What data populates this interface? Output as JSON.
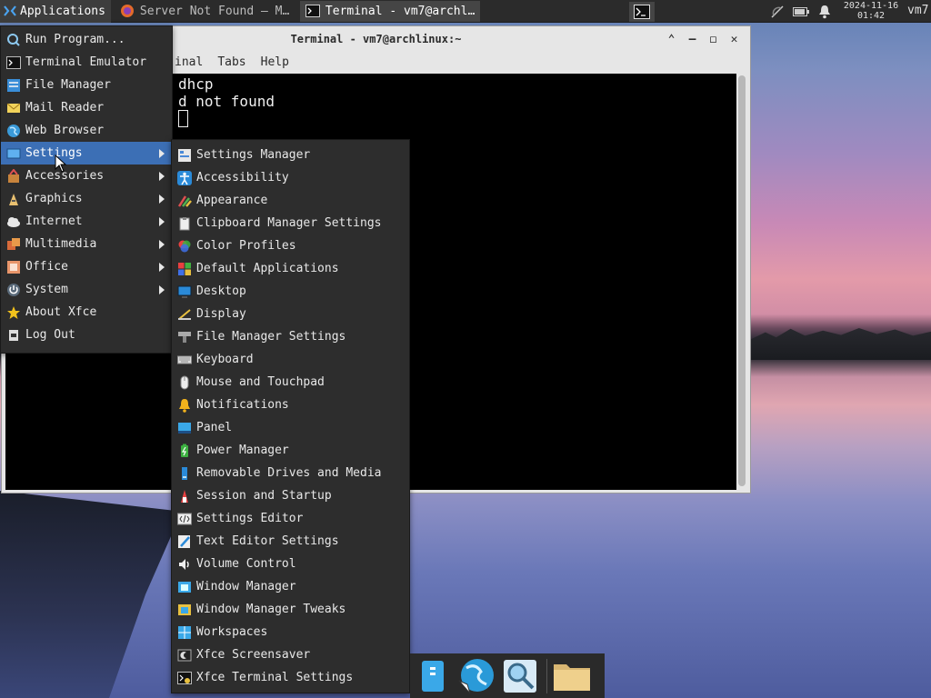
{
  "panel": {
    "applications_label": "Applications",
    "tasks": [
      {
        "label": "Server Not Found — M…",
        "active": false
      },
      {
        "label": "Terminal - vm7@archl…",
        "active": true
      }
    ],
    "clock_date": "2024-11-16",
    "clock_time": "01:42",
    "user": "vm7"
  },
  "terminal": {
    "title": "Terminal - vm7@archlinux:~",
    "menus": [
      "inal",
      "Tabs",
      "Help"
    ],
    "lines": [
      "dhcp",
      "d not found"
    ]
  },
  "main_menu": {
    "items": [
      {
        "label": "Run Program...",
        "icon": "run-icon",
        "submenu": false
      },
      {
        "label": "Terminal Emulator",
        "icon": "terminal-icon",
        "submenu": false
      },
      {
        "label": "File Manager",
        "icon": "file-manager-icon",
        "submenu": false
      },
      {
        "label": "Mail Reader",
        "icon": "mail-icon",
        "submenu": false
      },
      {
        "label": "Web Browser",
        "icon": "web-browser-icon",
        "submenu": false
      },
      {
        "label": "Settings",
        "icon": "settings-icon",
        "submenu": true,
        "highlighted": true
      },
      {
        "label": "Accessories",
        "icon": "accessories-icon",
        "submenu": true
      },
      {
        "label": "Graphics",
        "icon": "graphics-icon",
        "submenu": true
      },
      {
        "label": "Internet",
        "icon": "internet-icon",
        "submenu": true
      },
      {
        "label": "Multimedia",
        "icon": "multimedia-icon",
        "submenu": true
      },
      {
        "label": "Office",
        "icon": "office-icon",
        "submenu": true
      },
      {
        "label": "System",
        "icon": "system-icon",
        "submenu": true
      },
      {
        "label": "About Xfce",
        "icon": "star-icon",
        "submenu": false
      },
      {
        "label": "Log Out",
        "icon": "logout-icon",
        "submenu": false
      }
    ]
  },
  "settings_menu": {
    "items": [
      {
        "label": "Settings Manager",
        "icon": "settings-manager-icon"
      },
      {
        "label": "Accessibility",
        "icon": "accessibility-icon"
      },
      {
        "label": "Appearance",
        "icon": "appearance-icon"
      },
      {
        "label": "Clipboard Manager Settings",
        "icon": "clipboard-icon"
      },
      {
        "label": "Color Profiles",
        "icon": "color-profiles-icon"
      },
      {
        "label": "Default Applications",
        "icon": "default-apps-icon"
      },
      {
        "label": "Desktop",
        "icon": "desktop-icon"
      },
      {
        "label": "Display",
        "icon": "display-icon"
      },
      {
        "label": "File Manager Settings",
        "icon": "file-manager-settings-icon"
      },
      {
        "label": "Keyboard",
        "icon": "keyboard-icon"
      },
      {
        "label": "Mouse and Touchpad",
        "icon": "mouse-icon"
      },
      {
        "label": "Notifications",
        "icon": "bell-icon"
      },
      {
        "label": "Panel",
        "icon": "panel-icon"
      },
      {
        "label": "Power Manager",
        "icon": "battery-icon"
      },
      {
        "label": "Removable Drives and Media",
        "icon": "removable-drive-icon"
      },
      {
        "label": "Session and Startup",
        "icon": "session-icon"
      },
      {
        "label": "Settings Editor",
        "icon": "settings-editor-icon"
      },
      {
        "label": "Text Editor Settings",
        "icon": "text-editor-icon"
      },
      {
        "label": "Volume Control",
        "icon": "volume-icon"
      },
      {
        "label": "Window Manager",
        "icon": "window-manager-icon"
      },
      {
        "label": "Window Manager Tweaks",
        "icon": "window-tweaks-icon"
      },
      {
        "label": "Workspaces",
        "icon": "workspaces-icon"
      },
      {
        "label": "Xfce Screensaver",
        "icon": "screensaver-icon"
      },
      {
        "label": "Xfce Terminal Settings",
        "icon": "terminal-settings-icon"
      }
    ]
  },
  "colors": {
    "highlight": "#3c6fb5",
    "menu_bg": "#2d2d2d",
    "panel_bg": "#2b2b2b"
  }
}
